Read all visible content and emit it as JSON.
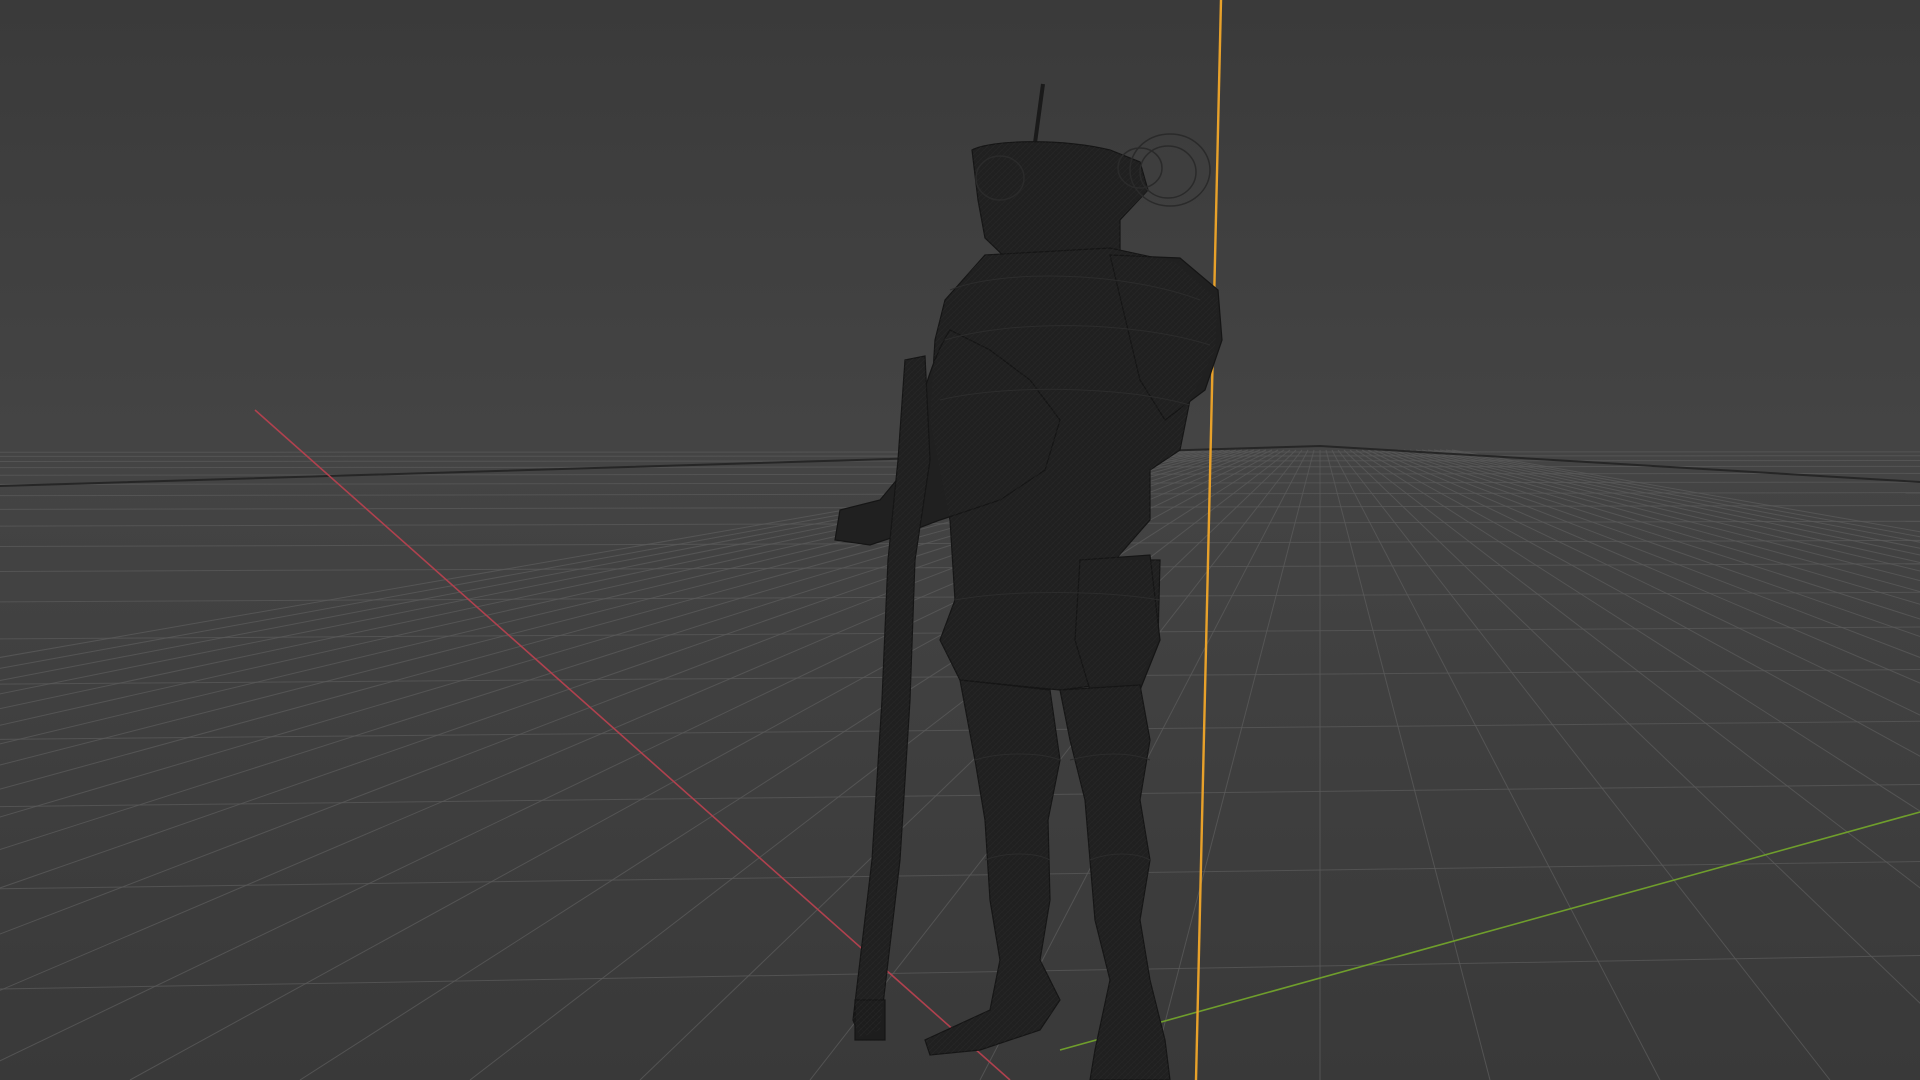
{
  "viewport": {
    "view_mode": "wireframe",
    "background_color": "#3d3d3d",
    "floor_color": "#3a3a3a",
    "grid_color": "#5a5a5a",
    "horizon_color": "#262626",
    "x_axis_color": "#b0414e",
    "y_axis_color": "#6f9e2c",
    "z_axis_color": "#e8a12a",
    "wire_color": "#1c1c1c",
    "model_fill_color": "#202020"
  },
  "scene_object": {
    "name_icon": "armored-robot-with-rifle",
    "state": "unselected"
  }
}
